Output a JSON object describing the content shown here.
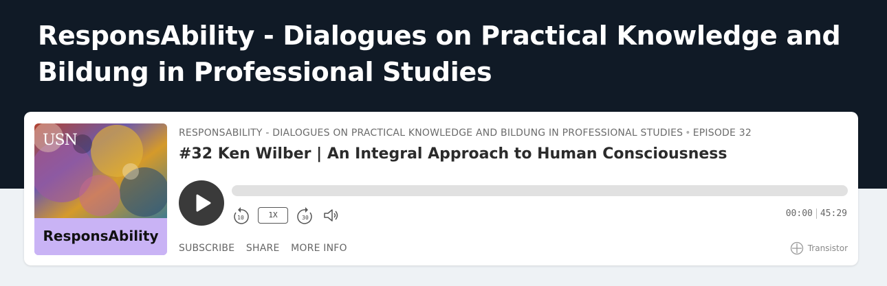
{
  "page": {
    "title": "ResponsAbility - Dialogues on Practical Knowledge and Bildung in Professional Studies"
  },
  "player": {
    "artwork": {
      "title": "ResponsAbility",
      "logo_text": "USN"
    },
    "show_name": "RESPONSABILITY - DIALOGUES ON PRACTICAL KNOWLEDGE AND BILDUNG IN PROFESSIONAL STUDIES",
    "separator": "•",
    "episode_label": "EPISODE 32",
    "episode_title": "#32 Ken Wilber | An Integral Approach to Human Consciousness",
    "progress_fraction": 0,
    "skip_back_seconds": "10",
    "skip_forward_seconds": "30",
    "speed": "1X",
    "current_time": "00:00",
    "duration": "45:29",
    "links": {
      "subscribe": "SUBSCRIBE",
      "share": "SHARE",
      "more_info": "MORE INFO"
    },
    "brand": "Transistor"
  },
  "colors": {
    "hero_bg": "#101a26",
    "page_bg": "#eef2f5",
    "artwork_accent": "#c9b3f5",
    "play_button": "#3a3a3a"
  },
  "icons": [
    "play-icon",
    "skip-back-10-icon",
    "skip-forward-30-icon",
    "volume-icon",
    "transistor-logo-icon"
  ]
}
